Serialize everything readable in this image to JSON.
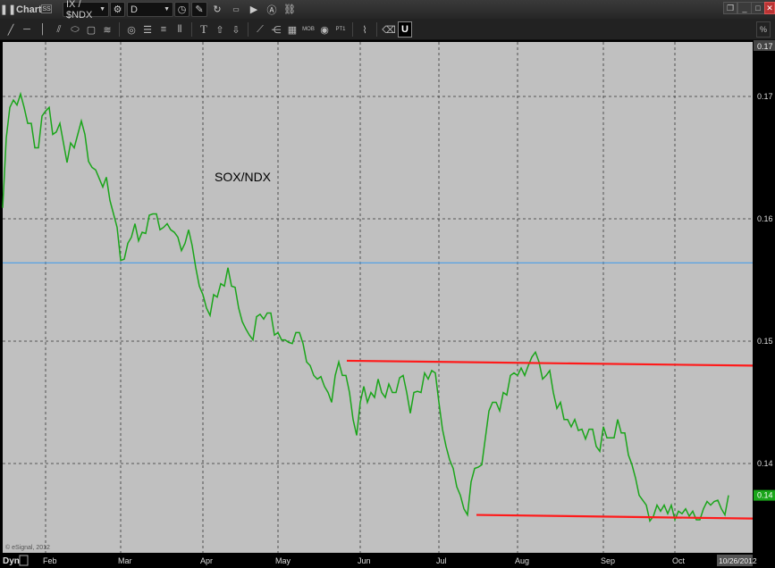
{
  "window": {
    "title": "Chart",
    "symbol": "IX / $NDX",
    "interval": "D",
    "badge": "SS"
  },
  "toolbar_icons": [
    "line-icon",
    "horizontal-line-icon",
    "vertical-line-icon",
    "fib-icon",
    "ellipse-icon",
    "rectangle-icon",
    "channel-icon",
    "circle-target-icon",
    "horizontal-lines-icon",
    "lines-icon",
    "vertical-lines-icon",
    "text-icon",
    "arrow-up-icon",
    "arrow-down-icon",
    "gann-icon",
    "fan-icon",
    "grid-icon",
    "mob-icon",
    "eye-icon",
    "pt-icon",
    "cycle-icon",
    "eraser-icon",
    "magnet-icon"
  ],
  "toolbar_labels": {
    "text": "T",
    "mob": "MOB",
    "pt": "PT1",
    "magnet": "U"
  },
  "chart_data": {
    "type": "line",
    "title": "SOX/NDX",
    "copyright": "© eSignal, 2012",
    "ylim": [
      0.1326,
      0.1742
    ],
    "y_ticks": [
      {
        "label": "0.17",
        "value": 0.17
      },
      {
        "label": "0.16",
        "value": 0.16
      },
      {
        "label": "0.15",
        "value": 0.15
      },
      {
        "label": "0.14",
        "value": 0.14
      }
    ],
    "top_label": "0.17",
    "current_value_label": "0.14",
    "current_value": 0.1374,
    "x_labels": [
      {
        "label": "Feb",
        "index": 12
      },
      {
        "label": "Mar",
        "index": 33
      },
      {
        "label": "Apr",
        "index": 56
      },
      {
        "label": "May",
        "index": 77
      },
      {
        "label": "Jun",
        "index": 100
      },
      {
        "label": "Jul",
        "index": 122
      },
      {
        "label": "Aug",
        "index": 144
      },
      {
        "label": "Sep",
        "index": 168
      },
      {
        "label": "Oct",
        "index": 188
      }
    ],
    "date_label": "10/26/2012",
    "dyn_label": "Dyn",
    "colors": {
      "series": "#1aa51a",
      "trend": "#ff1a1a",
      "level": "#4a9ee8",
      "background": "#c0c0c0"
    },
    "horizontal_level": 0.1564,
    "trendlines": [
      {
        "start_index": 96.25,
        "start": 0.1484,
        "end": 0.148
      },
      {
        "start_index": 132.5,
        "start": 0.1358,
        "end": 0.1355
      }
    ],
    "series": [
      {
        "name": "SOX/NDX",
        "values": [
          0.1609,
          0.1666,
          0.1691,
          0.1697,
          0.1693,
          0.1702,
          0.1691,
          0.1678,
          0.1678,
          0.1658,
          0.1658,
          0.1684,
          0.1688,
          0.1691,
          0.1669,
          0.1671,
          0.1678,
          0.1662,
          0.1646,
          0.1662,
          0.1658,
          0.1669,
          0.168,
          0.1669,
          0.1647,
          0.1642,
          0.164,
          0.1633,
          0.1626,
          0.1634,
          0.1615,
          0.1604,
          0.1593,
          0.1566,
          0.1567,
          0.158,
          0.1585,
          0.1596,
          0.1582,
          0.1589,
          0.1588,
          0.1603,
          0.1604,
          0.1604,
          0.1591,
          0.1593,
          0.1596,
          0.1591,
          0.1589,
          0.1585,
          0.1574,
          0.158,
          0.1591,
          0.1578,
          0.156,
          0.1545,
          0.1538,
          0.1527,
          0.1521,
          0.1538,
          0.1536,
          0.1547,
          0.1545,
          0.156,
          0.1545,
          0.1544,
          0.1527,
          0.1516,
          0.151,
          0.1505,
          0.1501,
          0.152,
          0.1522,
          0.1518,
          0.1523,
          0.1523,
          0.1505,
          0.1507,
          0.1501,
          0.1501,
          0.1499,
          0.1498,
          0.1507,
          0.1507,
          0.1498,
          0.1483,
          0.148,
          0.1472,
          0.1469,
          0.1471,
          0.1463,
          0.1458,
          0.145,
          0.1472,
          0.1483,
          0.1472,
          0.1472,
          0.1458,
          0.1436,
          0.1423,
          0.145,
          0.1463,
          0.145,
          0.1458,
          0.1454,
          0.1469,
          0.1458,
          0.1454,
          0.1465,
          0.1458,
          0.1458,
          0.147,
          0.1472,
          0.1458,
          0.1441,
          0.1458,
          0.1459,
          0.1458,
          0.1474,
          0.1469,
          0.1476,
          0.1474,
          0.145,
          0.1428,
          0.1414,
          0.1403,
          0.1396,
          0.1381,
          0.1374,
          0.1363,
          0.1358,
          0.1385,
          0.1396,
          0.1397,
          0.1399,
          0.1421,
          0.1443,
          0.145,
          0.145,
          0.1443,
          0.1458,
          0.1456,
          0.1472,
          0.1474,
          0.1472,
          0.1478,
          0.1472,
          0.148,
          0.1487,
          0.1491,
          0.1483,
          0.1469,
          0.1472,
          0.1476,
          0.1458,
          0.1445,
          0.145,
          0.1436,
          0.1436,
          0.143,
          0.1436,
          0.1427,
          0.1428,
          0.142,
          0.1428,
          0.1428,
          0.1414,
          0.141,
          0.143,
          0.1421,
          0.1421,
          0.1421,
          0.1436,
          0.1425,
          0.1425,
          0.1407,
          0.1399,
          0.1388,
          0.1374,
          0.137,
          0.1366,
          0.1353,
          0.1357,
          0.1366,
          0.1361,
          0.1366,
          0.1359,
          0.1366,
          0.1354,
          0.1361,
          0.1359,
          0.1363,
          0.1357,
          0.1361,
          0.1354,
          0.1354,
          0.1363,
          0.1369,
          0.1366,
          0.1369,
          0.137,
          0.1363,
          0.1358,
          0.1374
        ]
      }
    ]
  }
}
